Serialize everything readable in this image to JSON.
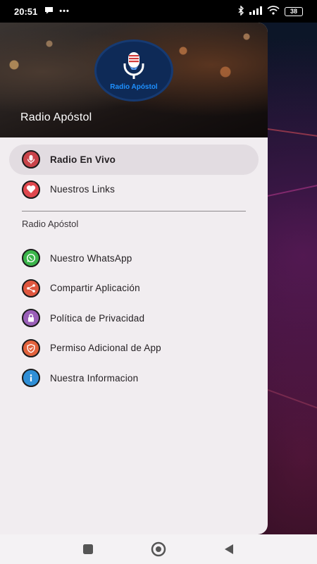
{
  "status_bar": {
    "time": "20:51",
    "battery": "38"
  },
  "drawer": {
    "title": "Radio Apóstol",
    "logo_text": "Radio Apóstol",
    "items_top": [
      {
        "label": "Radio En Vivo",
        "icon": "radio-mic-icon",
        "active": true
      },
      {
        "label": "Nuestros Links",
        "icon": "heart-icon",
        "active": false
      }
    ],
    "section_title": "Radio Apóstol",
    "items_section": [
      {
        "label": "Nuestro WhatsApp",
        "icon": "whatsapp-icon"
      },
      {
        "label": "Compartir Aplicación",
        "icon": "share-icon"
      },
      {
        "label": "Política de Privacidad",
        "icon": "privacy-lock-icon"
      },
      {
        "label": "Permiso Adicional de App",
        "icon": "shield-icon"
      },
      {
        "label": "Nuestra Informacion",
        "icon": "info-icon"
      }
    ]
  },
  "nav_bar": {
    "buttons": [
      "recents-square-icon",
      "home-circle-icon",
      "back-triangle-icon"
    ]
  },
  "colors": {
    "drawer_bg": "#f1edf0",
    "active_item_bg": "#e2dce1",
    "logo_bg": "#0e2a57",
    "logo_text": "#1e90ff"
  }
}
